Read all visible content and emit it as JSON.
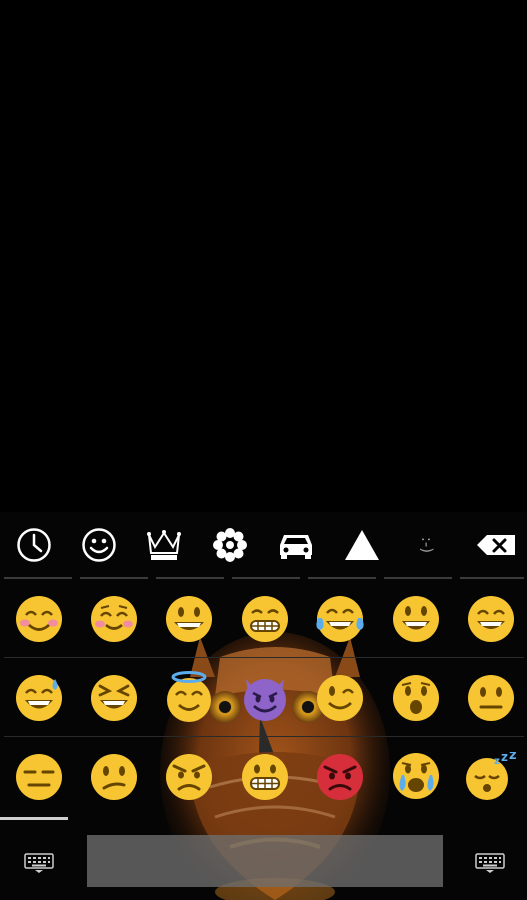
{
  "screen": {
    "top_area": "empty"
  },
  "categories": [
    {
      "icon": "clock-recent-icon"
    },
    {
      "icon": "smiley-icon"
    },
    {
      "icon": "crown-icon"
    },
    {
      "icon": "flower-icon"
    },
    {
      "icon": "car-icon"
    },
    {
      "icon": "triangle-symbols-icon"
    },
    {
      "icon": "emoticon-icon",
      "text": ":-)"
    },
    {
      "icon": "backspace-icon"
    }
  ],
  "emoji_rows": [
    [
      "blush",
      "smiling-eyes-blush",
      "grin",
      "grimace",
      "tears-of-joy",
      "open-mouth-smile",
      "grin-closed-eyes"
    ],
    [
      "sweat-smile",
      "squint-laugh",
      "halo",
      "smiling-devil",
      "wink",
      "hushed",
      "neutral"
    ],
    [
      "expressionless",
      "confused",
      "angry",
      "grimace",
      "pouting-red",
      "crying-open",
      "sleeping"
    ]
  ],
  "bottom_bar": {
    "left": "keyboard-icon",
    "right": "keyboard-icon"
  },
  "colors": {
    "emoji_yellow": "#f7c531",
    "devil_purple": "#8e64c8",
    "pout_red": "#d62f3b",
    "background": "#000000"
  }
}
